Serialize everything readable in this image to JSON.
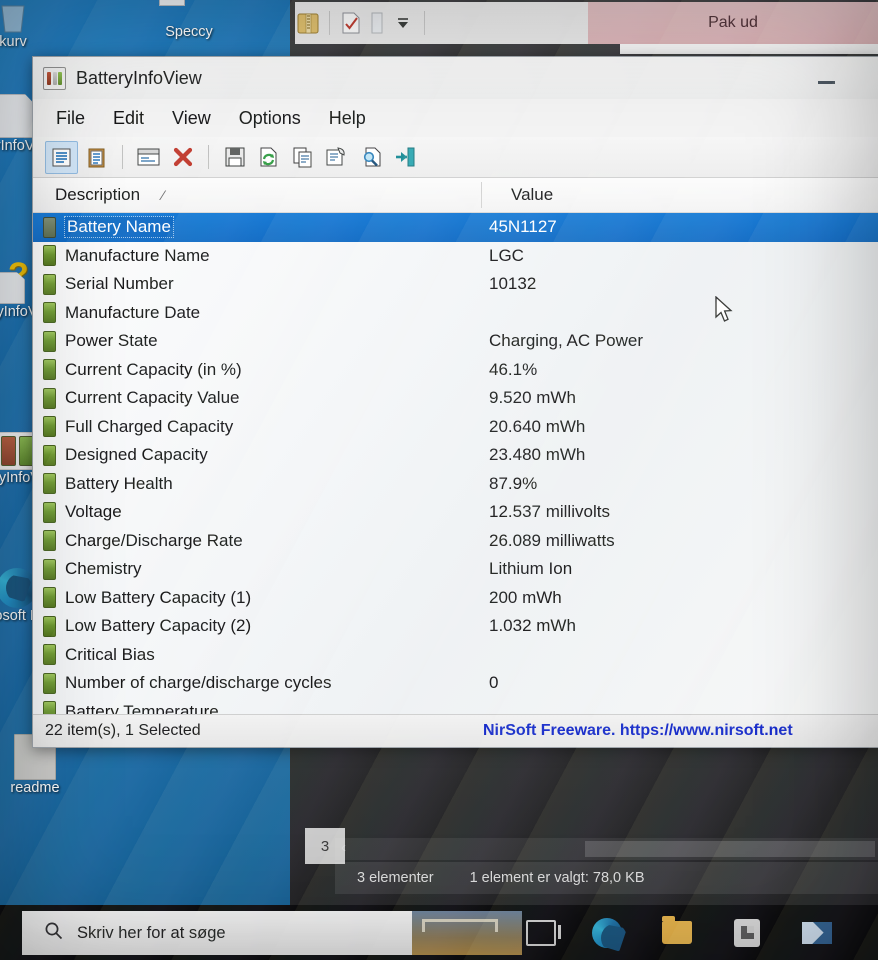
{
  "desktop": {
    "icons": [
      {
        "name": "papirkurv",
        "label": "kurv",
        "glyph": "recycle-bin-icon"
      },
      {
        "name": "speccy",
        "label": "Speccy",
        "glyph": "speccy-icon"
      },
      {
        "name": "batteryinfoview-1",
        "label": "ryInfoVie",
        "glyph": "file-icon"
      },
      {
        "name": "batteryinfoview-2",
        "label": "yInfoV",
        "glyph": "help-file-icon"
      },
      {
        "name": "batteryinfoview-3",
        "label": "ryInfoV",
        "glyph": "battery-icon"
      },
      {
        "name": "edge",
        "label": "osoft E",
        "glyph": "edge-icon"
      },
      {
        "name": "readme",
        "label": "readme",
        "glyph": "file-icon"
      }
    ]
  },
  "explorer": {
    "extract_button_label": "Pak ud",
    "status": {
      "item_count": "3 elementer",
      "selection": "1 element er valgt: 78,0 KB"
    },
    "page_tab": "3",
    "scroll_left_glyph": "‹"
  },
  "window": {
    "title": "BatteryInfoView",
    "minimize_label": "—",
    "menu": [
      {
        "label": "File"
      },
      {
        "label": "Edit"
      },
      {
        "label": "View"
      },
      {
        "label": "Options"
      },
      {
        "label": "Help"
      }
    ],
    "toolbar": [
      {
        "name": "list-view-button",
        "icon": "list-view-icon",
        "active": true
      },
      {
        "name": "clipboard-button",
        "icon": "clipboard-icon",
        "active": false
      },
      {
        "name": "properties-button",
        "icon": "properties-window-icon",
        "active": false
      },
      {
        "name": "delete-button",
        "icon": "red-x-icon",
        "active": false
      },
      {
        "name": "save-button",
        "icon": "floppy-disk-icon",
        "active": false
      },
      {
        "name": "refresh-button",
        "icon": "refresh-page-icon",
        "active": false
      },
      {
        "name": "copy-button",
        "icon": "copy-pages-icon",
        "active": false
      },
      {
        "name": "html-report-button",
        "icon": "html-report-icon",
        "active": false
      },
      {
        "name": "find-button",
        "icon": "find-magnifier-icon",
        "active": false
      },
      {
        "name": "exit-button",
        "icon": "exit-door-icon",
        "active": false
      }
    ],
    "columns": {
      "description": "Description",
      "value": "Value",
      "sort_indicator": "⁄"
    },
    "rows": [
      {
        "description": "Battery Name",
        "value": "45N1127",
        "selected": true
      },
      {
        "description": "Manufacture Name",
        "value": "LGC",
        "selected": false
      },
      {
        "description": "Serial Number",
        "value": "10132",
        "selected": false
      },
      {
        "description": "Manufacture Date",
        "value": "",
        "selected": false
      },
      {
        "description": "Power State",
        "value": "Charging, AC Power",
        "selected": false
      },
      {
        "description": "Current Capacity (in %)",
        "value": "46.1%",
        "selected": false
      },
      {
        "description": "Current Capacity Value",
        "value": "9.520 mWh",
        "selected": false
      },
      {
        "description": "Full Charged Capacity",
        "value": "20.640 mWh",
        "selected": false
      },
      {
        "description": "Designed Capacity",
        "value": "23.480 mWh",
        "selected": false
      },
      {
        "description": "Battery Health",
        "value": "87.9%",
        "selected": false
      },
      {
        "description": "Voltage",
        "value": "12.537 millivolts",
        "selected": false
      },
      {
        "description": "Charge/Discharge Rate",
        "value": "26.089 milliwatts",
        "selected": false
      },
      {
        "description": "Chemistry",
        "value": "Lithium Ion",
        "selected": false
      },
      {
        "description": "Low Battery Capacity (1)",
        "value": "200 mWh",
        "selected": false
      },
      {
        "description": "Low Battery Capacity (2)",
        "value": "1.032 mWh",
        "selected": false
      },
      {
        "description": "Critical Bias",
        "value": "",
        "selected": false
      },
      {
        "description": "Number of charge/discharge cycles",
        "value": "0",
        "selected": false
      },
      {
        "description": "Battery Temperature",
        "value": "",
        "selected": false
      }
    ],
    "statusbar": {
      "count": "22 item(s), 1 Selected",
      "nirsoft": "NirSoft Freeware. https://www.nirsoft.net"
    }
  },
  "taskbar": {
    "search_placeholder": "Skriv her for at søge",
    "buttons": [
      {
        "name": "task-view-button",
        "icon": "task-view-icon"
      },
      {
        "name": "edge-button",
        "icon": "edge-icon"
      },
      {
        "name": "file-explorer-button",
        "icon": "folder-icon"
      },
      {
        "name": "microsoft-store-button",
        "icon": "store-icon"
      },
      {
        "name": "mail-button",
        "icon": "mail-icon"
      }
    ]
  },
  "colors": {
    "selection_blue": "#1277d4",
    "desktop_blue": "#1a6fb0",
    "nirsoft_link": "#1126c8",
    "battery_green": "#6e9a30",
    "extract_pink": "#dcb2b6"
  }
}
